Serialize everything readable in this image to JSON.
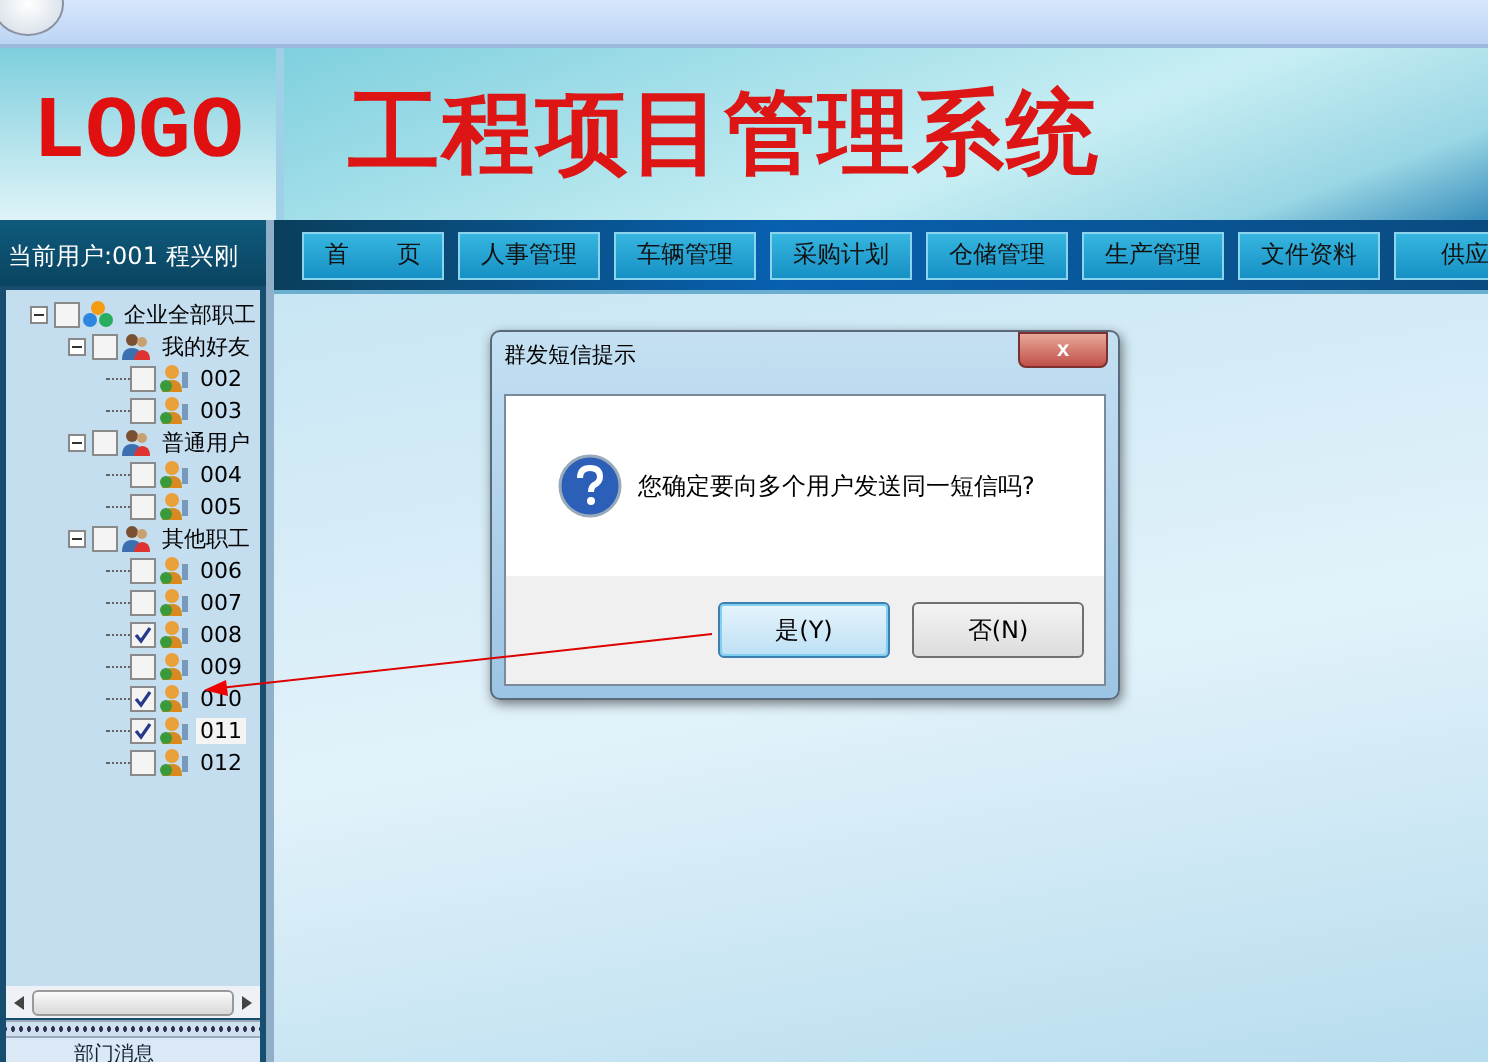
{
  "header": {
    "logo": "LOGO",
    "title": "工程项目管理系统"
  },
  "current_user": "当前用户:001 程兴刚",
  "nav": [
    {
      "label": "首　　页"
    },
    {
      "label": "人事管理"
    },
    {
      "label": "车辆管理"
    },
    {
      "label": "采购计划"
    },
    {
      "label": "仓储管理"
    },
    {
      "label": "生产管理"
    },
    {
      "label": "文件资料"
    },
    {
      "label": "供应"
    }
  ],
  "tree": [
    {
      "label": "企业全部职工",
      "checked": false,
      "expanded": true,
      "selected": false,
      "children": [
        {
          "label": "我的好友",
          "checked": false,
          "expanded": true,
          "selected": false,
          "children": [
            {
              "label": "002",
              "checked": false,
              "selected": false
            },
            {
              "label": "003",
              "checked": false,
              "selected": false
            }
          ]
        },
        {
          "label": "普通用户",
          "checked": false,
          "expanded": true,
          "selected": false,
          "children": [
            {
              "label": "004",
              "checked": false,
              "selected": false
            },
            {
              "label": "005",
              "checked": false,
              "selected": false
            }
          ]
        },
        {
          "label": "其他职工",
          "checked": false,
          "expanded": true,
          "selected": false,
          "children": [
            {
              "label": "006",
              "checked": false,
              "selected": false
            },
            {
              "label": "007",
              "checked": false,
              "selected": false
            },
            {
              "label": "008",
              "checked": true,
              "selected": false
            },
            {
              "label": "009",
              "checked": false,
              "selected": false
            },
            {
              "label": "010",
              "checked": true,
              "selected": false
            },
            {
              "label": "011",
              "checked": true,
              "selected": true
            },
            {
              "label": "012",
              "checked": false,
              "selected": false
            }
          ]
        }
      ]
    }
  ],
  "sidebar_bottom": "部门消息",
  "dialog": {
    "title": "群发短信提示",
    "close": "x",
    "message": "您确定要向多个用户发送同一短信吗?",
    "buttons": [
      {
        "label": "是(Y)",
        "selected": true
      },
      {
        "label": "否(N)",
        "selected": false
      }
    ]
  }
}
